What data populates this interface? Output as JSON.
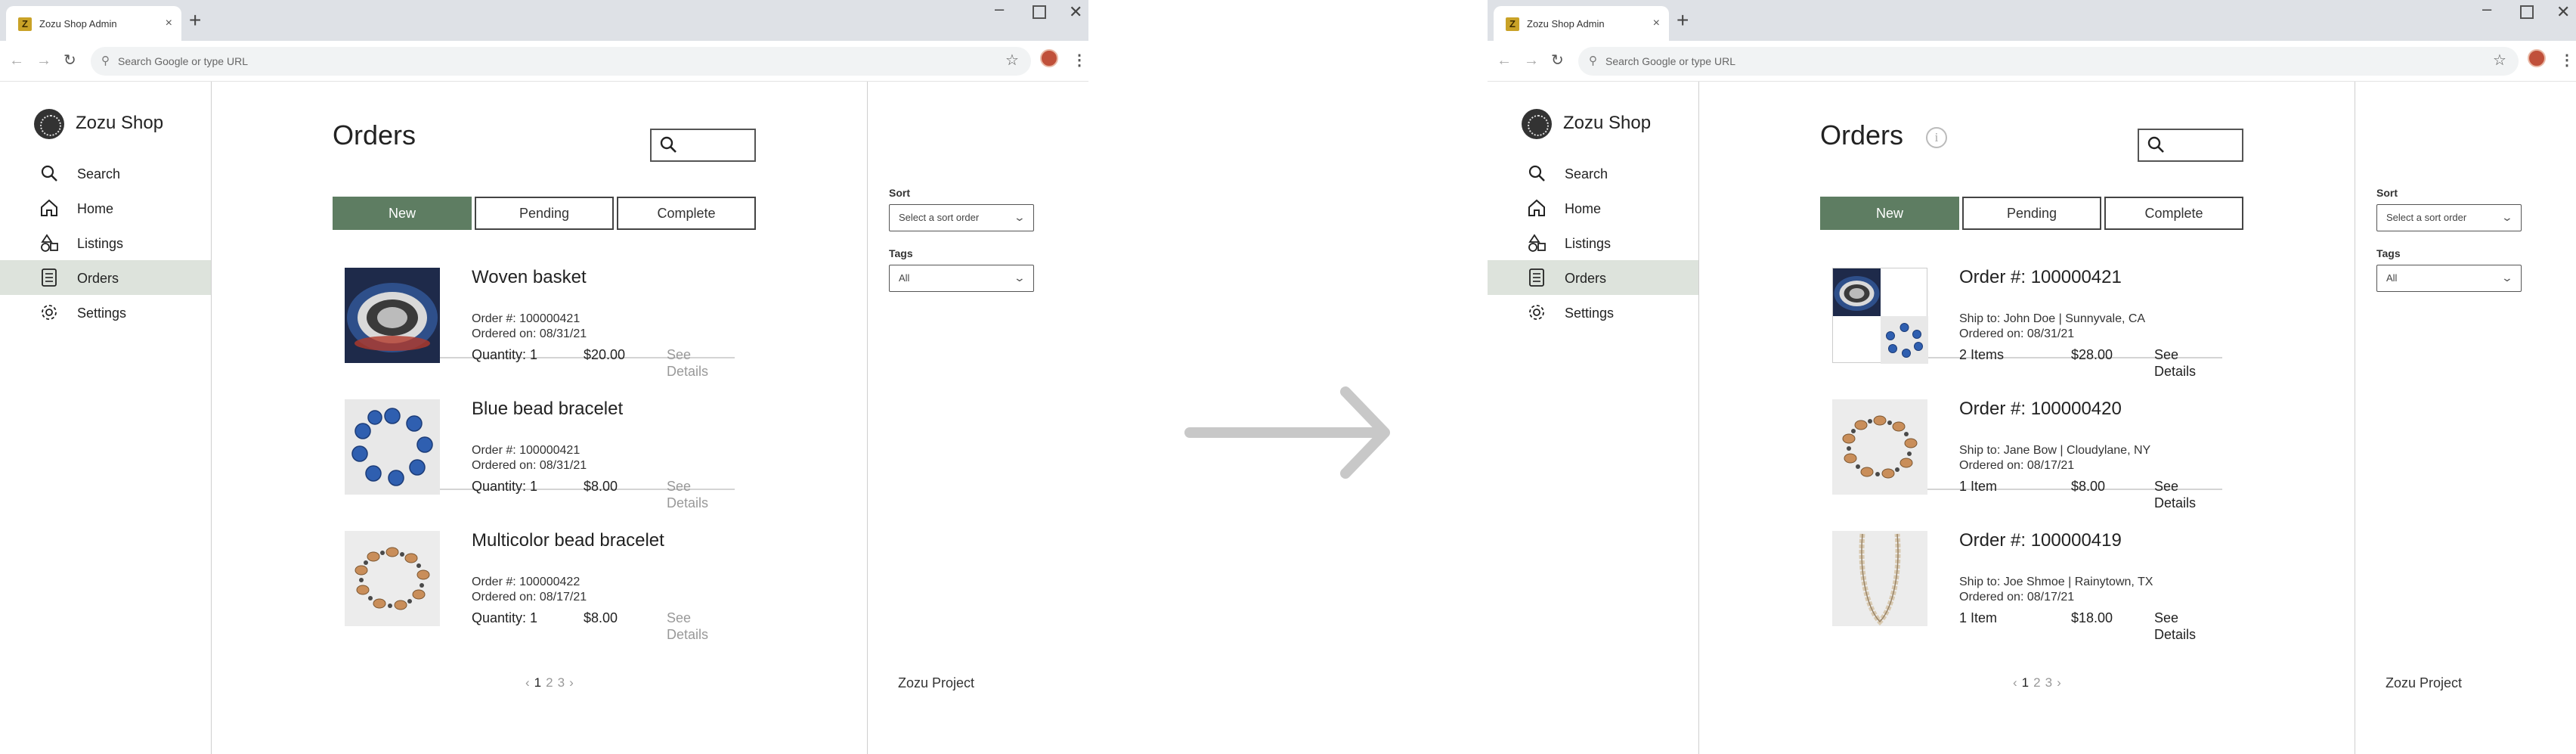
{
  "browser": {
    "tab_title": "Zozu Shop Admin",
    "favicon_letter": "Z",
    "new_tab": "+",
    "tab_close": "×",
    "omnibox_placeholder": "Search Google or type URL"
  },
  "sidebar": {
    "brand": "Zozu Shop",
    "items": [
      {
        "label": "Search",
        "icon": "search-icon"
      },
      {
        "label": "Home",
        "icon": "home-icon"
      },
      {
        "label": "Listings",
        "icon": "shapes-icon"
      },
      {
        "label": "Orders",
        "icon": "receipt-icon",
        "active": true
      },
      {
        "label": "Settings",
        "icon": "gear-icon"
      }
    ]
  },
  "main": {
    "title": "Orders",
    "info_glyph": "i",
    "tabs": [
      {
        "label": "New",
        "active": true
      },
      {
        "label": "Pending"
      },
      {
        "label": "Complete"
      }
    ],
    "pagination": {
      "prev": "‹",
      "pages": [
        "1",
        "2",
        "3"
      ],
      "current": "1",
      "next": "›"
    }
  },
  "before": {
    "items": [
      {
        "title": "Woven basket",
        "line1": "Order #: 100000421",
        "line2": "Ordered on: 08/31/21",
        "qty": "Quantity: 1",
        "price": "$20.00",
        "details": "See Details"
      },
      {
        "title": "Blue bead bracelet",
        "line1": "Order #: 100000421",
        "line2": "Ordered on: 08/31/21",
        "qty": "Quantity: 1",
        "price": "$8.00",
        "details": "See Details"
      },
      {
        "title": "Multicolor bead bracelet",
        "line1": "Order #: 100000422",
        "line2": "Ordered on: 08/17/21",
        "qty": "Quantity: 1",
        "price": "$8.00",
        "details": "See Details"
      }
    ]
  },
  "after": {
    "items": [
      {
        "title": "Order #: 100000421",
        "line1": "Ship to: John Doe | Sunnyvale, CA",
        "line2": "Ordered on: 08/31/21",
        "qty": "2 Items",
        "price": "$28.00",
        "details": "See Details"
      },
      {
        "title": "Order #: 100000420",
        "line1": "Ship to: Jane Bow | Cloudylane, NY",
        "line2": "Ordered on: 08/17/21",
        "qty": "1 Item",
        "price": "$8.00",
        "details": "See Details"
      },
      {
        "title": "Order #: 100000419",
        "line1": "Ship to: Joe Shmoe | Rainytown, TX",
        "line2": "Ordered on: 08/17/21",
        "qty": "1 Item",
        "price": "$18.00",
        "details": "See Details"
      }
    ]
  },
  "filters": {
    "sort_label": "Sort",
    "sort_value": "Select a sort order",
    "tags_label": "Tags",
    "tags_value": "All",
    "footer": "Zozu Project"
  },
  "colors": {
    "accent": "#5e7d62",
    "active_nav": "#dde3dc",
    "arrow": "#c8c8c8"
  }
}
